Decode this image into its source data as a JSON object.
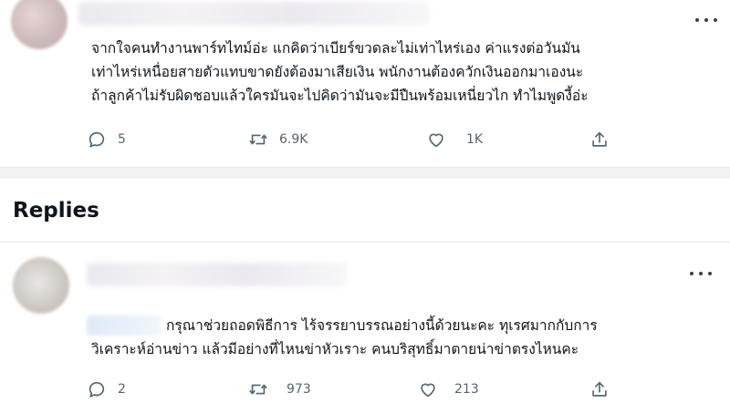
{
  "tweet": {
    "lines": [
      "จากใจคนทำงานพาร์ทไทม์อ่ะ แกคิดว่าเบียร์ขวดละไม่เท่าไหร่เอง ค่าแรงต่อวันมัน",
      "เท่าไหร่เหนื่อยสายตัวแทบขาดยังต้องมาเสียเงิน พนักงานต้องควักเงินออกมาเองนะ",
      "ถ้าลูกค้าไม่รับผิดชอบแล้วใครมันจะไปคิดว่ามันจะมีปืนพร้อมเหนี่ยวไก ทำไมพูดงี้อ่ะ"
    ],
    "reply_count": "5",
    "retweet_count": "6.9K",
    "like_count": "1K"
  },
  "replies_heading": "Replies",
  "reply": {
    "lines": [
      "กรุณาช่วยถอดพิธีการ ไร้จรรยาบรรณอย่างนี้ด้วยนะคะ ทุเรศมากกับการ",
      "วิเคราะห์อ่านข่าว   แล้วมีอย่างที่ไหนข่าหัวเราะ  คนบริสุทธิ์มาตายน่าข่าตรงไหนคะ"
    ],
    "reply_count": "2",
    "retweet_count": "973",
    "like_count": "213"
  },
  "icons": {
    "more": "more-horizontal-icon",
    "reply": "reply-bubble-icon",
    "retweet": "retweet-icon",
    "like": "heart-icon",
    "share": "share-upload-icon"
  }
}
